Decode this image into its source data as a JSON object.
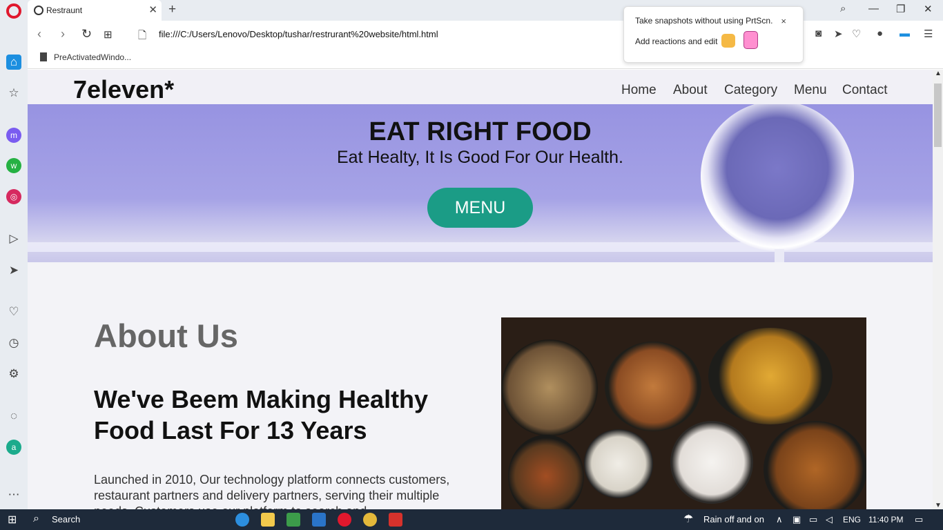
{
  "browser": {
    "tab_title": "Restraunt",
    "url": "file:///C:/Users/Lenovo/Desktop/tushar/restrurant%20website/html.html",
    "bookmark": "PreActivatedWindo..."
  },
  "popup": {
    "line1": "Take snapshots without using PrtScn.",
    "line2": "Add reactions and edit",
    "close": "×"
  },
  "site": {
    "logo": "7eleven*",
    "nav": [
      "Home",
      "About",
      "Category",
      "Menu",
      "Contact"
    ],
    "hero": {
      "title": "EAT RIGHT FOOD",
      "subtitle": "Eat Healty, It Is Good For Our Health.",
      "button": "MENU"
    },
    "about": {
      "title": "About Us",
      "heading": "We've Beem Making Healthy Food Last For 13 Years",
      "text": "Launched in 2010, Our technology platform connects customers, restaurant partners and delivery partners, serving their multiple needs. Customers use our platform to search and"
    }
  },
  "taskbar": {
    "search": "Search",
    "weather": "Rain off and on",
    "lang": "ENG",
    "time": "11:40 PM"
  },
  "colors": {
    "accent_button": "#1b9c86",
    "hero_bg": "#a6a3e6",
    "opera_red": "#e0182d"
  }
}
